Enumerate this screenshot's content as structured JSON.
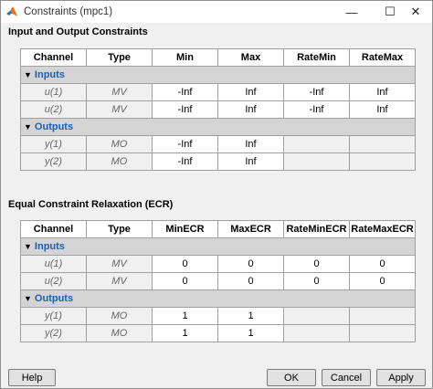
{
  "window": {
    "title": "Constraints (mpc1)",
    "minimize": "—",
    "maximize": "☐",
    "close": "✕"
  },
  "io": {
    "title": "Input and Output Constraints",
    "headers": [
      "Channel",
      "Type",
      "Min",
      "Max",
      "RateMin",
      "RateMax"
    ],
    "inputs_label": "Inputs",
    "inputs": [
      {
        "channel": "u(1)",
        "type": "MV",
        "v1": "-Inf",
        "v2": "Inf",
        "v3": "-Inf",
        "v4": "Inf"
      },
      {
        "channel": "u(2)",
        "type": "MV",
        "v1": "-Inf",
        "v2": "Inf",
        "v3": "-Inf",
        "v4": "Inf"
      }
    ],
    "outputs_label": "Outputs",
    "outputs": [
      {
        "channel": "y(1)",
        "type": "MO",
        "v1": "-Inf",
        "v2": "Inf"
      },
      {
        "channel": "y(2)",
        "type": "MO",
        "v1": "-Inf",
        "v2": "Inf"
      }
    ]
  },
  "ecr": {
    "title": "Equal Constraint Relaxation (ECR)",
    "headers": [
      "Channel",
      "Type",
      "MinECR",
      "MaxECR",
      "RateMinECR",
      "RateMaxECR"
    ],
    "inputs_label": "Inputs",
    "inputs": [
      {
        "channel": "u(1)",
        "type": "MV",
        "v1": "0",
        "v2": "0",
        "v3": "0",
        "v4": "0"
      },
      {
        "channel": "u(2)",
        "type": "MV",
        "v1": "0",
        "v2": "0",
        "v3": "0",
        "v4": "0"
      }
    ],
    "outputs_label": "Outputs",
    "outputs": [
      {
        "channel": "y(1)",
        "type": "MO",
        "v1": "1",
        "v2": "1"
      },
      {
        "channel": "y(2)",
        "type": "MO",
        "v1": "1",
        "v2": "1"
      }
    ]
  },
  "buttons": {
    "help": "Help",
    "ok": "OK",
    "cancel": "Cancel",
    "apply": "Apply"
  }
}
